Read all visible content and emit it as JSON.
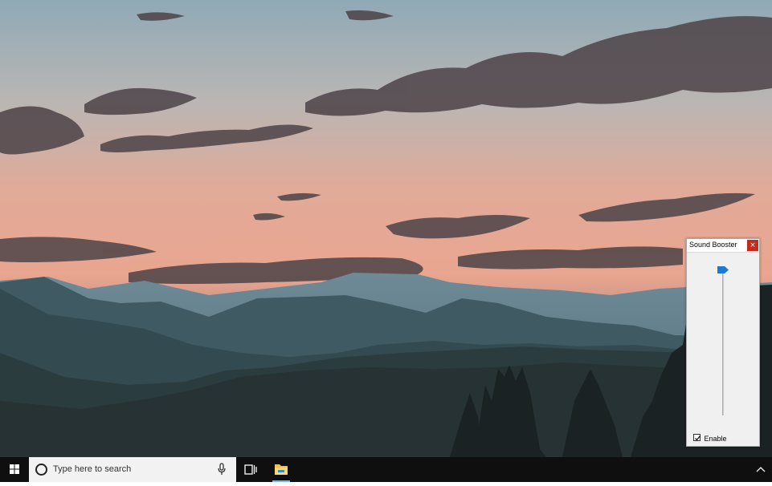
{
  "sound_booster": {
    "title": "Sound Booster",
    "close_glyph": "×",
    "enable_label": "Enable",
    "enable_checked": true,
    "volume_level": 0.98
  },
  "taskbar": {
    "search_placeholder": "Type here to search",
    "icons": [
      "windows-start-icon",
      "cortana-circle-icon",
      "microphone-icon",
      "task-view-icon",
      "file-explorer-icon",
      "chevron-up-icon"
    ]
  },
  "colors": {
    "taskbar": "#0f0f10",
    "close_button": "#c42b1c",
    "slider_thumb": "#1e78d2",
    "explorer_folder": "#f4c24b"
  }
}
